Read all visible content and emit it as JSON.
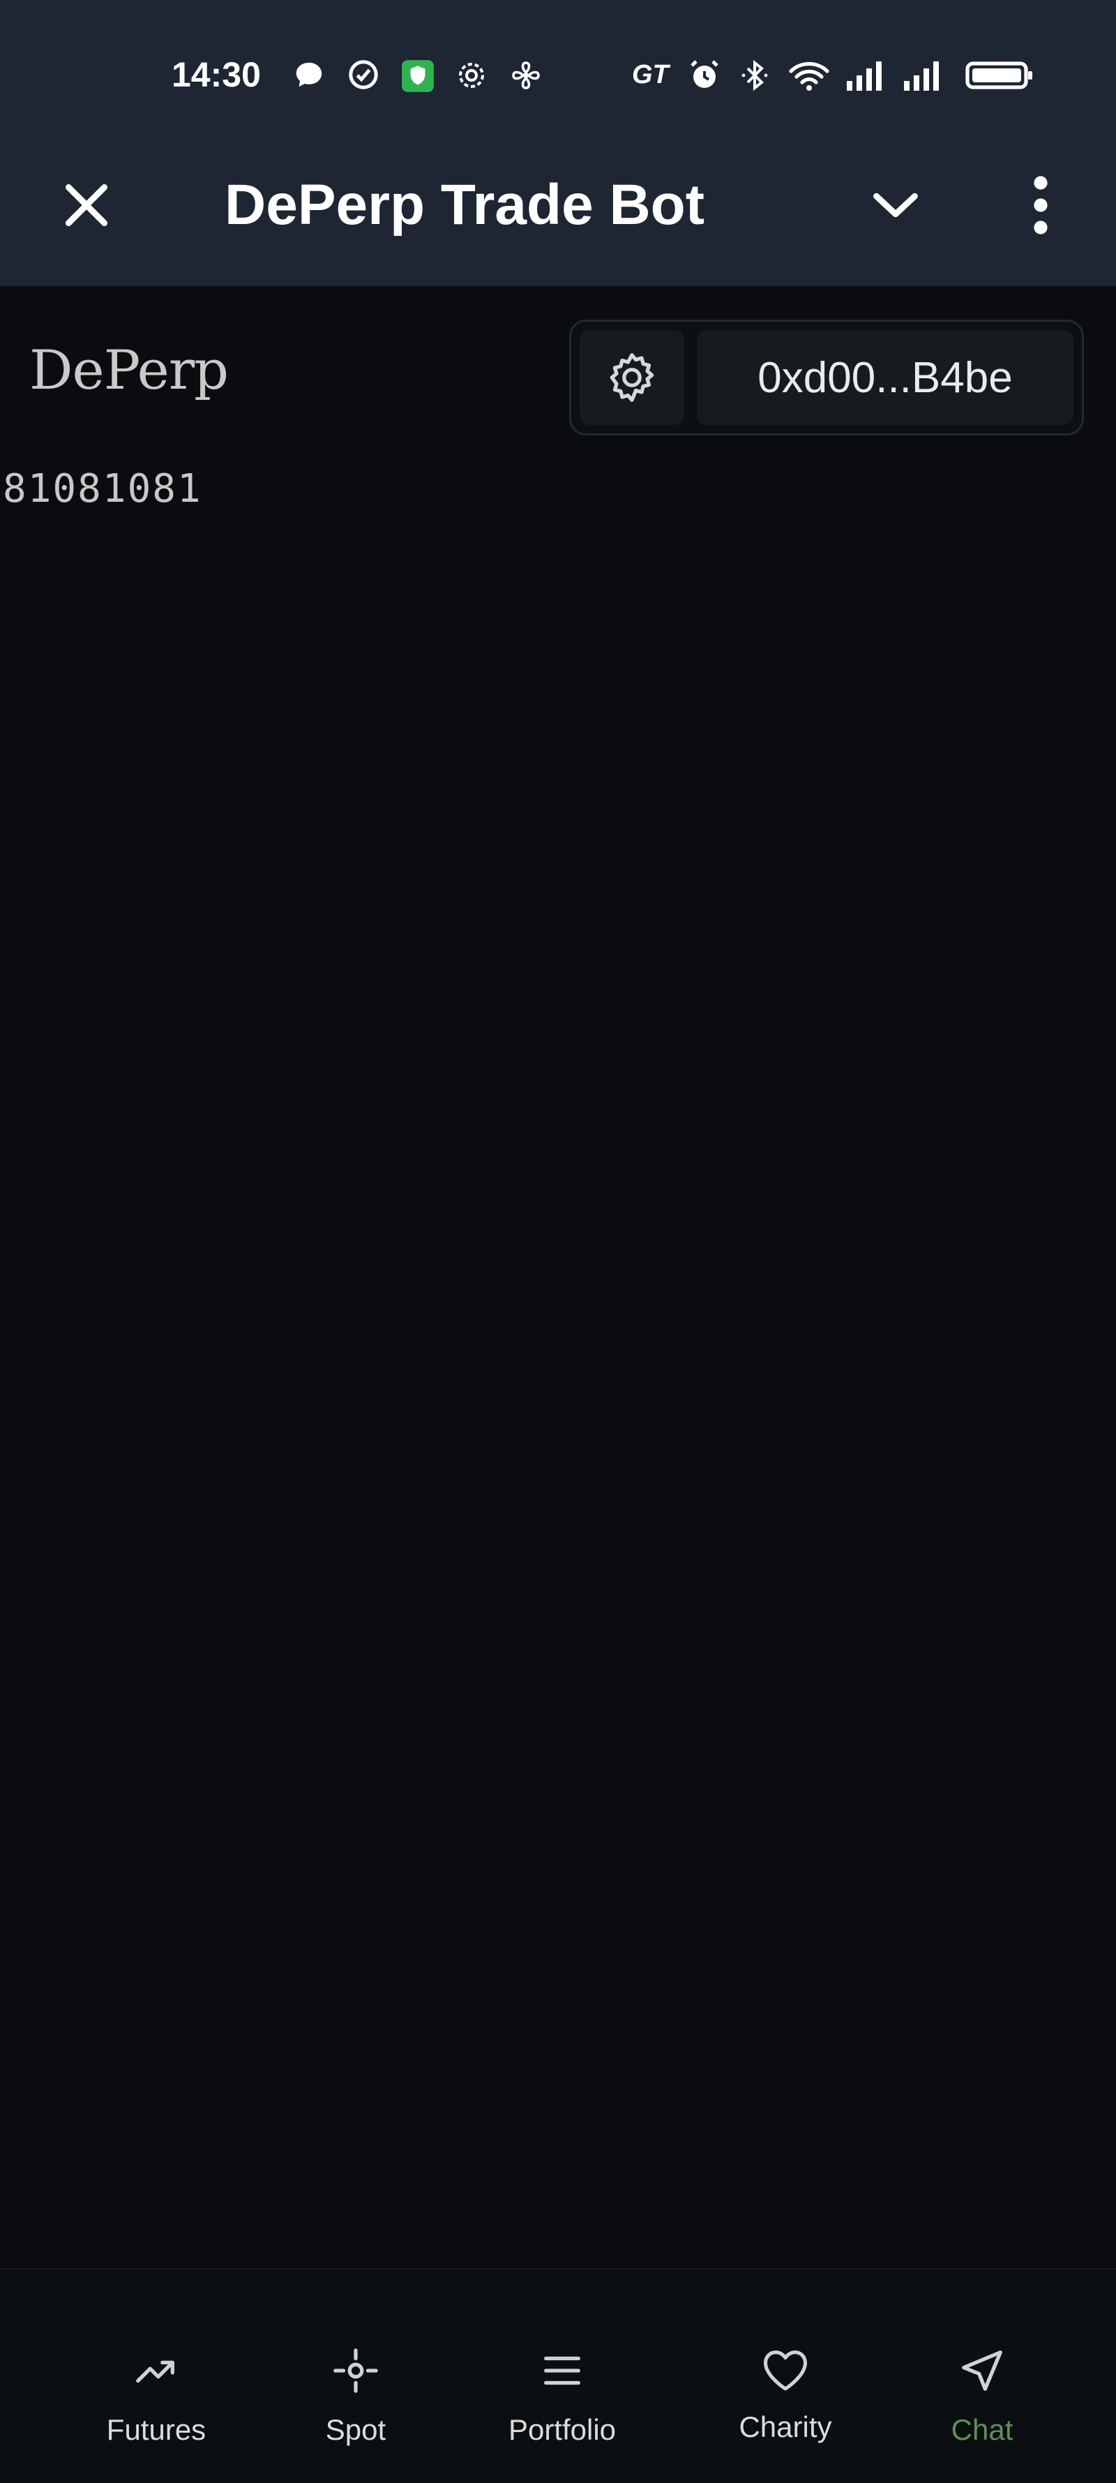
{
  "status_bar": {
    "time": "14:30",
    "network_label": "GT",
    "icons": [
      "chat-bubble-icon",
      "check-circle-icon",
      "shield-icon",
      "settings-gear-icon",
      "fan-icon",
      "alarm-icon",
      "bluetooth-icon",
      "wifi-icon",
      "signal-icon",
      "signal-icon",
      "battery-icon"
    ]
  },
  "toolbar": {
    "title": "DePerp Trade Bot",
    "close_icon": "close-icon",
    "collapse_icon": "chevron-down-icon",
    "menu_icon": "more-vertical-icon"
  },
  "header": {
    "brand": "DePerp",
    "wallet_address": "0xd00...B4be",
    "settings_icon": "gear-icon"
  },
  "content": {
    "counter_text": "81081081"
  },
  "bottom_nav": {
    "items": [
      {
        "label": "Futures",
        "icon": "trending-up-icon"
      },
      {
        "label": "Spot",
        "icon": "crosshair-icon"
      },
      {
        "label": "Portfolio",
        "icon": "menu-lines-icon"
      },
      {
        "label": "Charity",
        "icon": "heart-icon"
      },
      {
        "label": "Chat",
        "icon": "send-icon",
        "active": true
      }
    ],
    "active_color": "#5f8f57"
  },
  "colors": {
    "bar_background": "#1d2632",
    "page_background": "#0a0c0f"
  }
}
